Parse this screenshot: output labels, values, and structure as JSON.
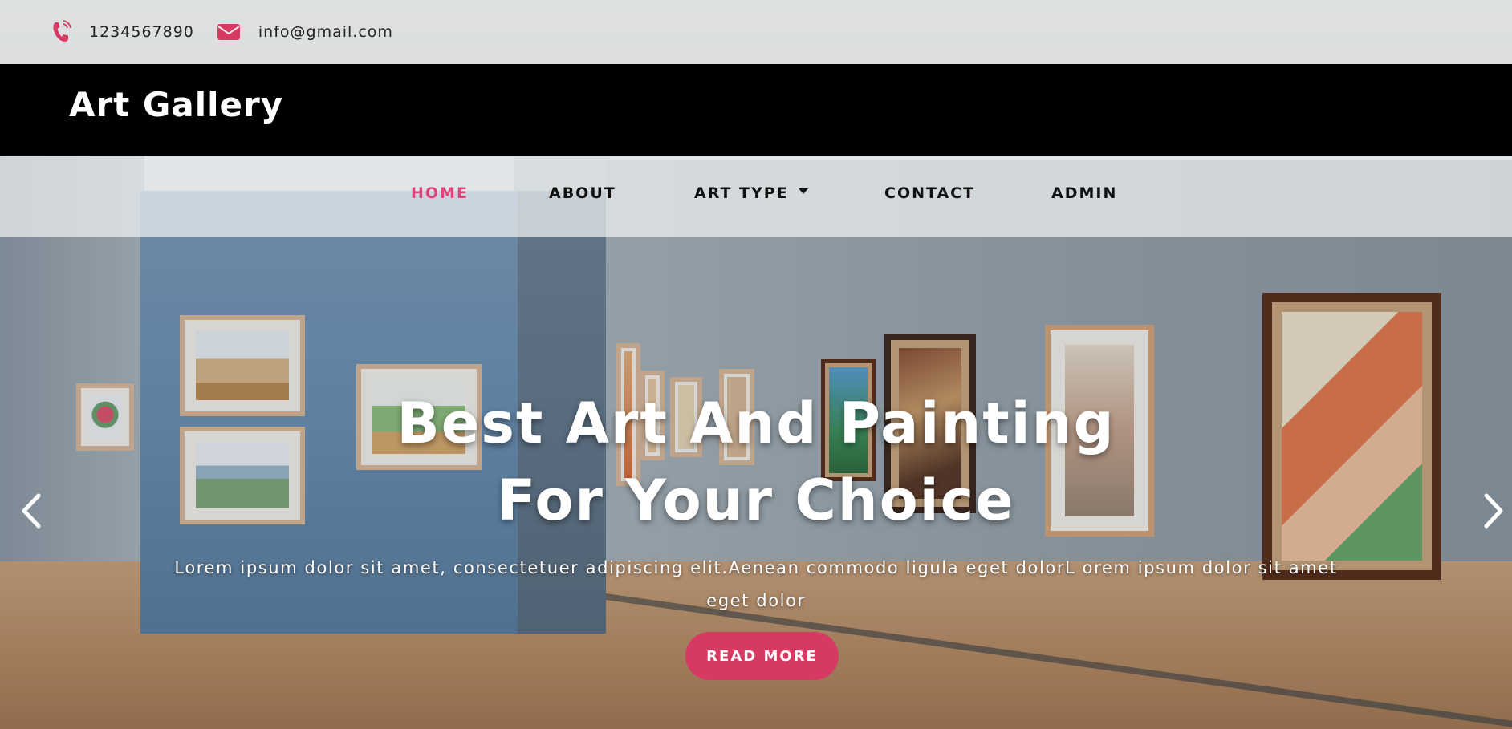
{
  "topbar": {
    "phone": "1234567890",
    "phone_icon": "phone-icon",
    "email": "info@gmail.com",
    "email_icon": "envelope-icon",
    "icon_color": "#d63a63"
  },
  "brand": {
    "name": "Art Gallery"
  },
  "nav": {
    "active_color": "#e0457a",
    "items": [
      {
        "label": "HOME",
        "active": true
      },
      {
        "label": "ABOUT"
      },
      {
        "label": "ART TYPE",
        "dropdown": true
      },
      {
        "label": "CONTACT"
      },
      {
        "label": "ADMIN"
      }
    ]
  },
  "hero": {
    "title_line1": "Best Art And Painting",
    "title_line2": "For Your Choice",
    "text": "Lorem ipsum dolor sit amet, consectetuer adipiscing elit.Aenean commodo ligula eget dolorL orem ipsum dolor sit amet eget dolor",
    "button_label": "READ MORE",
    "button_color": "#d63a63",
    "prev_icon": "chevron-left-icon",
    "next_icon": "chevron-right-icon"
  }
}
